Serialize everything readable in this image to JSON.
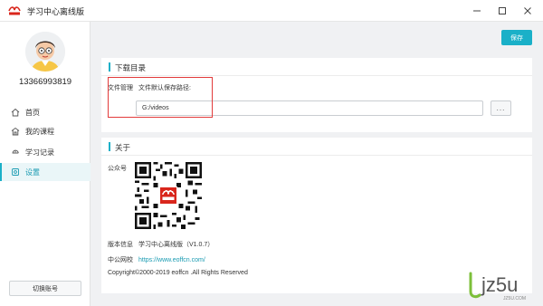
{
  "window": {
    "title": "学习中心离线版",
    "logo_text": "offcn"
  },
  "user": {
    "phone": "13366993819"
  },
  "sidebar": {
    "items": [
      {
        "label": "首页",
        "icon": "home-icon"
      },
      {
        "label": "我的课程",
        "icon": "course-icon"
      },
      {
        "label": "学习记录",
        "icon": "history-icon"
      },
      {
        "label": "设置",
        "icon": "settings-icon",
        "active": true
      }
    ],
    "switch_account": "切换账号"
  },
  "toolbar": {
    "save_label": "保存"
  },
  "download": {
    "section_title": "下载目录",
    "file_manage_label": "文件管理",
    "default_path_label": "文件默认保存路径:",
    "path_value": "G:/videos",
    "browse_label": "..."
  },
  "about": {
    "section_title": "关于",
    "wechat_label": "公众号",
    "version_label": "版本信息",
    "version_value": "学习中心离线版（V1.0.7）",
    "site_label": "中公网校",
    "site_url": "https://www.eoffcn.com/",
    "copyright": "Copyright©2000-2019 eoffcn .All Rights Reserved"
  },
  "watermark": {
    "brand": "jz5u",
    "sub": "JZ5U.COM"
  },
  "colors": {
    "accent": "#1ab0c8",
    "highlight": "#e23b3b",
    "link": "#1a9bb2"
  }
}
